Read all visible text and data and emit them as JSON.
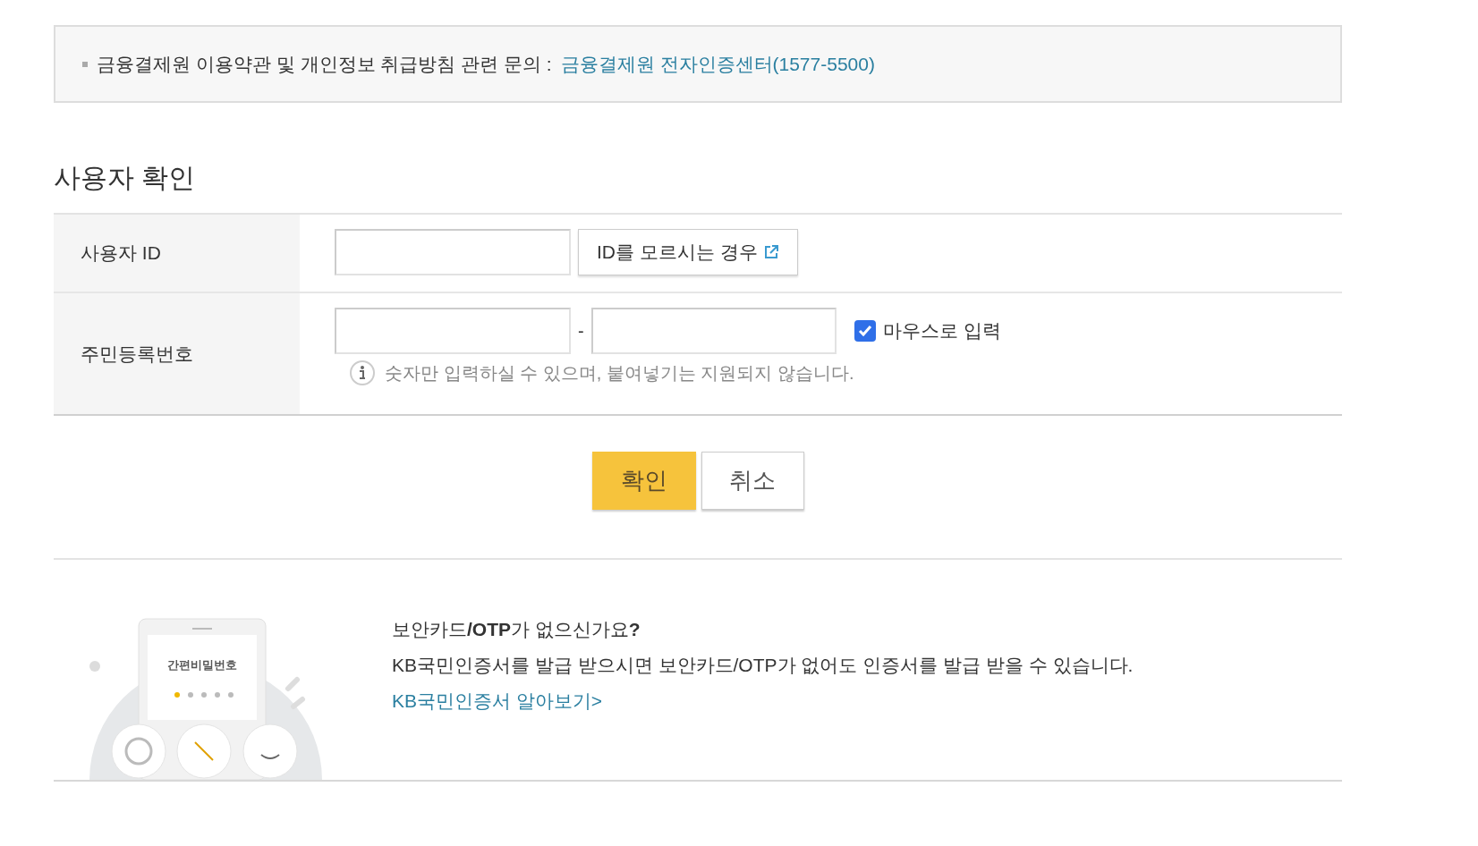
{
  "notice": {
    "text": "금융결제원 이용약관 및 개인정보 취급방침 관련 문의 :",
    "link": "금융결제원 전자인증센터(1577-5500)"
  },
  "section_title": "사용자 확인",
  "form": {
    "rows": [
      {
        "kind": "id",
        "label": "사용자 ID",
        "button": "ID를 모르시는 경우"
      },
      {
        "kind": "rrn",
        "label": "주민등록번호",
        "separator": "-",
        "checkbox": {
          "label": "마우스로 입력",
          "checked": true
        },
        "hint": "숫자만 입력하실 수 있으며, 붙여넣기는 지원되지 않습니다."
      }
    ]
  },
  "buttons": [
    {
      "label": "확인",
      "primary": true
    },
    {
      "label": "취소",
      "primary": false
    }
  ],
  "promo": {
    "illustration_label": "간편비밀번호",
    "title": "보안카드**/OTP**가 없으신가요**?**",
    "text": "KB국민인증서를 발급 받으시면 보안카드/OTP가 없어도 인증서를 발급 받을 수 있습니다.",
    "link": "KB국민인증서 알아보기>"
  }
}
